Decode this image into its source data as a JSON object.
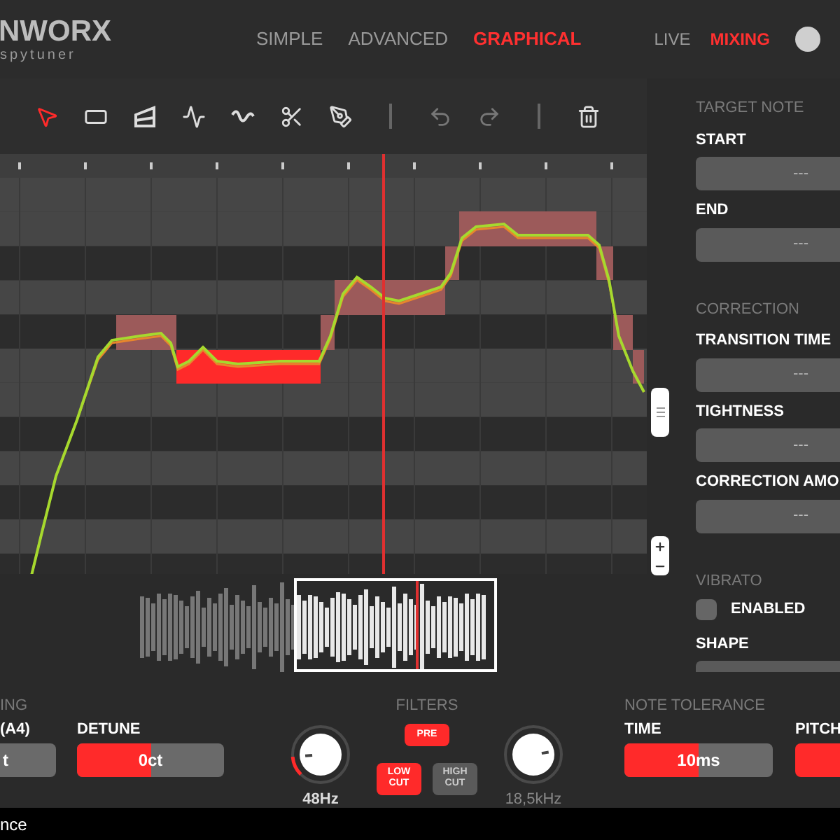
{
  "header": {
    "logo": "NWORX",
    "logo_sub": "spytuner",
    "modes": [
      {
        "label": "SIMPLE",
        "selected": false
      },
      {
        "label": "ADVANCED",
        "selected": false
      },
      {
        "label": "GRAPHICAL",
        "selected": true
      }
    ],
    "targets": [
      {
        "label": "LIVE",
        "selected": false
      },
      {
        "label": "MIXING",
        "selected": true
      }
    ]
  },
  "toolbar": {
    "tools": [
      {
        "kind": "pointer",
        "selected": true
      },
      {
        "kind": "rectangle",
        "selected": false
      },
      {
        "kind": "ramp",
        "selected": false
      },
      {
        "kind": "pulse",
        "selected": false
      },
      {
        "kind": "wave",
        "selected": false
      },
      {
        "kind": "scissors",
        "selected": false
      },
      {
        "kind": "pen",
        "selected": false
      }
    ],
    "history": [
      {
        "kind": "undo",
        "disabled": true
      },
      {
        "kind": "redo",
        "disabled": true
      }
    ],
    "actions": [
      {
        "kind": "delete",
        "disabled": false
      }
    ]
  },
  "inspector": {
    "sections": [
      {
        "title": "TARGET NOTE",
        "items": [
          {
            "kind": "field",
            "label": "START",
            "value": "---"
          },
          {
            "kind": "field",
            "label": "END",
            "value": "---"
          }
        ]
      },
      {
        "title": "CORRECTION",
        "items": [
          {
            "kind": "field",
            "label": "TRANSITION TIME",
            "value": "---"
          },
          {
            "kind": "field",
            "label": "TIGHTNESS",
            "value": "---"
          },
          {
            "kind": "field",
            "label": "CORRECTION AMO",
            "value": "---"
          }
        ]
      },
      {
        "title": "VIBRATO",
        "items": [
          {
            "kind": "checkbox",
            "label": "ENABLED",
            "checked": false
          },
          {
            "kind": "field",
            "label": "SHAPE"
          }
        ]
      }
    ]
  },
  "bottom": {
    "tuning": {
      "title": "ING",
      "label": "(A4)",
      "value": "t"
    },
    "detune": {
      "label": "DETUNE",
      "value": "0ct",
      "level": 0.5
    },
    "filters": {
      "title": "FILTERS",
      "low_knob": {
        "reading": "48Hz",
        "active": true
      },
      "high_knob": {
        "reading": "18,5kHz",
        "active": false
      },
      "buttons": [
        {
          "label": "PRE",
          "on": true
        },
        {
          "label": "LOW CUT",
          "on": true
        },
        {
          "label": "HIGH CUT",
          "on": false
        }
      ]
    },
    "note_tolerance": {
      "title": "NOTE TOLERANCE",
      "time": {
        "label": "TIME",
        "value": "10ms",
        "level": 0.5
      },
      "pitch": {
        "label": "PITCH"
      }
    }
  },
  "status_bar": {
    "text": "nce"
  }
}
